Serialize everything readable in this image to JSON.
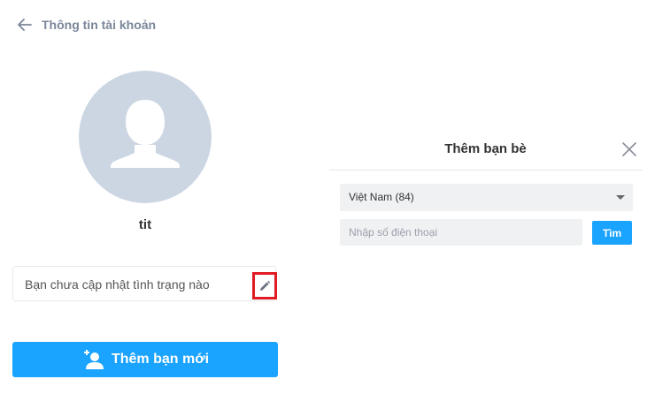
{
  "header": {
    "back_icon": "arrow-left-icon",
    "title": "Thông tin tài khoản"
  },
  "profile": {
    "avatar_icon": "default-user-silhouette",
    "username": "tit",
    "status_text": "Bạn chưa cập nhật tình trạng nào",
    "edit_icon": "pencil-icon",
    "add_friend_label": "Thêm bạn mới",
    "add_friend_icon": "add-user-icon"
  },
  "add_friend_panel": {
    "title": "Thêm bạn bè",
    "close_icon": "close-icon",
    "country_selected": "Việt Nam (84)",
    "phone_placeholder": "Nhập số điện thoại",
    "phone_value": "",
    "search_label": "Tìm"
  },
  "colors": {
    "accent": "#1aa3ff",
    "highlight_border": "#e01b24",
    "avatar_bg": "#ccd6e3"
  }
}
